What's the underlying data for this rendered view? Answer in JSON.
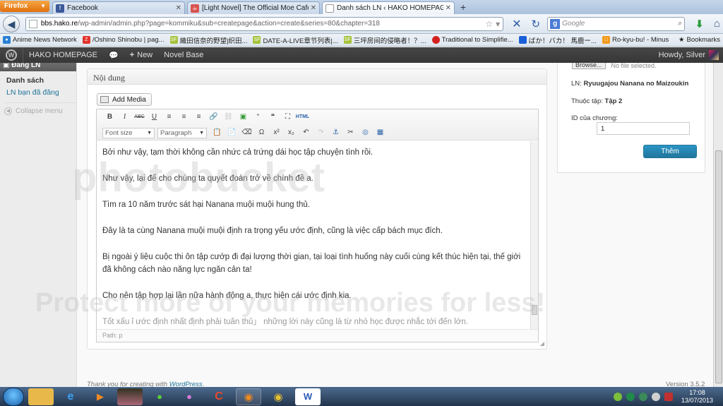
{
  "browser": {
    "menu_label": "Firefox",
    "tabs": [
      {
        "title": "Facebook",
        "icon": "facebook-icon",
        "color": "#3b5998",
        "glyph": "f"
      },
      {
        "title": "[Light Novel] The Official Moe Café ♥...",
        "icon": "moe-cafe-icon",
        "color": "#d9534f",
        "glyph": "☕"
      },
      {
        "title": "Danh sách LN ‹ HAKO HOMEPAGE —...",
        "icon": "blank-page-icon",
        "color": "#ffffff",
        "glyph": ""
      }
    ],
    "new_tab_glyph": "+",
    "url_host": "bbs.hako.re",
    "url_path": "/wp-admin/admin.php?page=kommiku&sub=createpage&action=create&series=80&chapter=318",
    "search_placeholder": "Google",
    "bookmarks": [
      {
        "label": "Anime News Network",
        "color": "#2a7fd4",
        "glyph": "●"
      },
      {
        "label": "/Oshino Shinobu | pag...",
        "color": "#e0342c",
        "glyph": "Z"
      },
      {
        "label": "織田信奈的野望|织田...",
        "color": "#a6c23a",
        "glyph": "SF"
      },
      {
        "label": "DATE-A-LIVE章节列表|...",
        "color": "#a6c23a",
        "glyph": "SF"
      },
      {
        "label": "三坪房间的侵略者！？...",
        "color": "#a6c23a",
        "glyph": "SF"
      },
      {
        "label": "Traditional to Simplifie...",
        "color": "#d42020",
        "glyph": "●"
      },
      {
        "label": "ばか！バカ！ 馬鹿ー...",
        "color": "#1a5fd8",
        "glyph": ""
      },
      {
        "label": "Ro-kyu-bu! - Minus",
        "color": "#f29a1a",
        "glyph": "□"
      }
    ],
    "bookmarks_menu": "Bookmarks"
  },
  "adminbar": {
    "site_name": "HAKO HOMEPAGE",
    "new_label": "New",
    "novel_base": "Novel Base",
    "howdy": "Howdy, Silver"
  },
  "sidebar": {
    "header": "Đăng LN",
    "items": [
      {
        "label": "Danh sách"
      },
      {
        "label": "LN bạn đã đăng"
      }
    ],
    "collapse": "Collapse menu"
  },
  "editor": {
    "box_title": "Nội dung",
    "add_media": "Add Media",
    "font_size": "Font size",
    "paragraph": "Paragraph",
    "html_button": "HTML",
    "paragraphs": [
      "Bởi như vậy, tạm thời không cần nhức cả trứng dái học tập chuyện tình rồi.",
      "Như vậy, lại để cho chúng ta quyết đoán trở về chính đề a.",
      "Tìm ra 10 năm trước sát hại Nanana muội muội hung thủ.",
      "Đây là ta cùng Nanana muội muội định ra trọng yếu ước định, cũng là việc cấp bách mục đích.",
      "Bị ngoài ý liệu cuộc thi ôn tập cướp đi đại lượng thời gian, tại loại tình huống này cuối cùng kết thúc hiện tại, thế giới đã không cách nào năng lực ngăn cản ta!",
      "Cho nên tập hợp lại lần nữa hành động a, thực hiện cái ước định kia.",
      "Tốt xấu ỉ ước định nhất định phải tuân thủ」 những lời này cũng là từ nhỏ học được nhắc tới đến lớn."
    ],
    "path": "Path: p"
  },
  "sidebox": {
    "browse_button": "Browse...",
    "no_file": "No file selected.",
    "ln_label": "LN:",
    "ln_value": "Ryuugajou Nanana no Maizoukin",
    "volume_label": "Thuộc tập:",
    "volume_value": "Tập 2",
    "chapter_id_label": "ID của chương:",
    "chapter_id_value": "1",
    "submit": "Thêm"
  },
  "footer": {
    "thanks_prefix": "Thank you for creating with ",
    "wordpress": "WordPress",
    "thanks_suffix": ".",
    "version": "Version 3.5.2"
  },
  "watermark": {
    "line1": "photobucket",
    "line2": "Protect more of your memories for less!"
  },
  "taskbar": {
    "time": "17:08",
    "date": "13/07/2013",
    "word_glyph": "W"
  }
}
